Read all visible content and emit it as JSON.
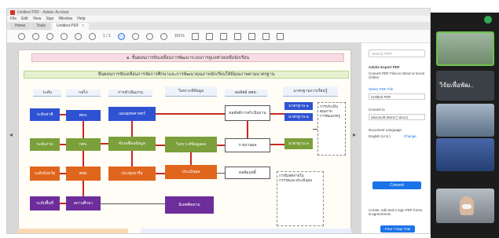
{
  "window": {
    "title": "Untitled PDF - Adobe Acrobat"
  },
  "menu": [
    "File",
    "Edit",
    "View",
    "Sign",
    "Window",
    "Help"
  ],
  "tabs": [
    {
      "label": "Home"
    },
    {
      "label": "Tools"
    },
    {
      "label": "Untitled PDF",
      "close": "×"
    }
  ],
  "toolbar": {
    "page": "1 / 1",
    "zoom": "101%"
  },
  "document": {
    "banner_top": "๑. ขั้นตอนการขับเคลื่อนการพัฒนาระบบการดูแลช่วยเหลือนักเรียน",
    "banner_sub": "ขั้นตอนการขับเคลื่อนการจัดการศึกษาและการพัฒนาคุณภาพนักเรียนให้มีคุณภาพตามมาตรฐาน",
    "headers": [
      "ระดับ",
      "กลไก",
      "การดำเนินงาน",
      "วิเคราะห์ข้อมูล",
      "ผลลัพธ์ สพท.",
      "มาตรฐานการเรียนรู้"
    ],
    "levels": [
      "ระดับชาติ",
      "ระดับภาค",
      "ระดับจังหวัด",
      "ระดับพื้นที่"
    ],
    "mechanism": [
      "ศธจ.",
      "กศจ.",
      "สพท.",
      "สถานศึกษา"
    ],
    "process": [
      "แผนยุทธศาสตร์",
      "ขับเคลื่อนข้อมูล",
      "ประชุมหารือ",
      "นิเทศติดตาม"
    ],
    "analysis": [
      "วิเคราะห์ข้อมูลผล",
      "ประเมินผล"
    ],
    "result": [
      "ผลลัพธ์การดำเนินงาน",
      "รายงานผล",
      "ผลสัมฤทธิ์"
    ],
    "standard": [
      "มาตรฐาน ๑",
      "มาตรฐาน ๒",
      "มาตรฐาน ๓"
    ],
    "notes": [
      "การประเมินคุณภาพ",
      "การพัฒนาครู",
      "การนิเทศภายใน",
      "การวัดและประเมินผล"
    ]
  },
  "side_panel": {
    "search_placeholder": "Search 'PDF'",
    "export_title": "Adobe Export PDF",
    "export_desc": "Convert PDF Files to Word or Excel Online",
    "select_label": "Select PDF File",
    "file_name": "Untitled PDF",
    "convert_to_label": "Convert to",
    "convert_to_value": "Microsoft Word (*.docx)",
    "language_label": "Document Language:",
    "language_value": "English (U.S.)",
    "language_change": "Change",
    "convert_button": "Convert",
    "promo": "Create, edit and e-sign PDF forms & agreements",
    "try_button": "Free 7-Day Trial"
  },
  "meeting": {
    "tile_names": [
      "",
      "วิจัยเพื่อพัฒ..",
      "",
      "",
      "",
      ""
    ]
  }
}
